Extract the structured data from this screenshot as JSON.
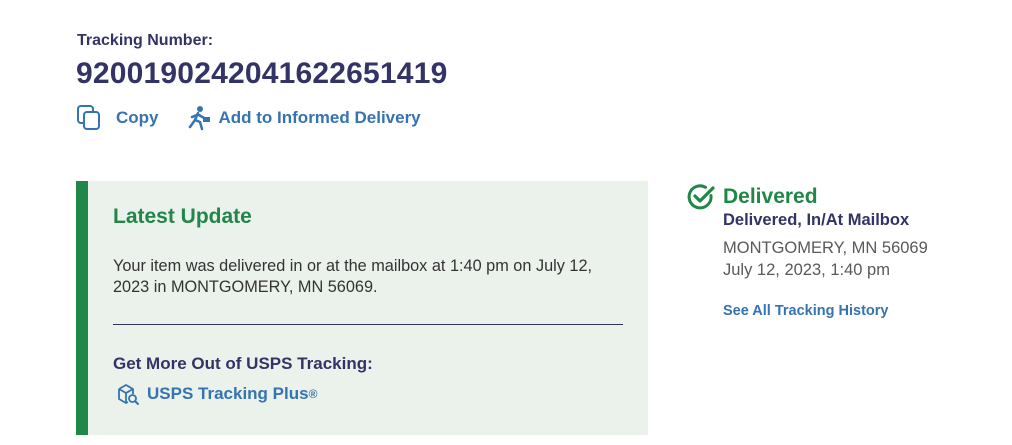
{
  "tracking": {
    "label": "Tracking Number:",
    "number": "9200190242041622651419"
  },
  "actions": {
    "copy_label": "Copy",
    "informed_delivery_label": "Add to Informed Delivery"
  },
  "latest_update": {
    "title": "Latest Update",
    "text": "Your item was delivered in or at the mailbox at 1:40 pm on July 12, 2023 in MONTGOMERY, MN 56069.",
    "more_title": "Get More Out of USPS Tracking:",
    "plus_label": "USPS Tracking Plus",
    "plus_mark": "®"
  },
  "status": {
    "title": "Delivered",
    "detail": "Delivered, In/At Mailbox",
    "location": "MONTGOMERY, MN 56069",
    "date": "July 12, 2023, 1:40 pm",
    "history_link": "See All Tracking History"
  },
  "colors": {
    "navy": "#333366",
    "green": "#218748",
    "link_blue": "#3573b1",
    "panel_bg": "#ebf2ec"
  },
  "icons": {
    "copy": "copy-icon",
    "informed_delivery": "mail-carrier-icon",
    "tracking_plus": "package-search-icon",
    "delivered": "check-circle-icon"
  }
}
